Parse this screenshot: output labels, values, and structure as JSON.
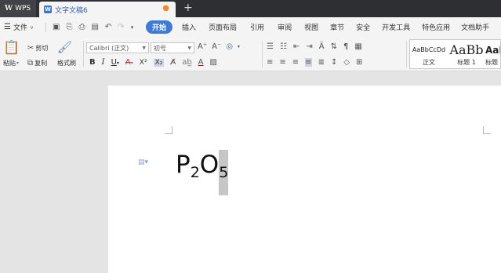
{
  "titlebar": {
    "app_name": "WPS",
    "doc_tab_title": "文字文稿6",
    "doc_icon_letter": "W",
    "close_glyph": "●",
    "new_tab_glyph": "+"
  },
  "menu": {
    "file_label": "文件",
    "tabs": [
      "开始",
      "插入",
      "页面布局",
      "引用",
      "审阅",
      "视图",
      "章节",
      "安全",
      "开发工具",
      "特色应用",
      "文档助手"
    ],
    "active_tab": "开始"
  },
  "ribbon": {
    "paste_label": "粘贴",
    "cut_label": "剪切",
    "copy_label": "复制",
    "format_painter_label": "格式刷",
    "font_name": "Calibri (正文)",
    "font_size": "初号",
    "bold": "B",
    "italic": "I",
    "underline": "U",
    "strike": "A",
    "superscript": "X²",
    "subscript": "X₂",
    "styles": [
      {
        "sample": "AaBbCcDd",
        "label": "正文"
      },
      {
        "sample": "AaBb",
        "label": "标题 1"
      },
      {
        "sample": "AaB",
        "label": "标题"
      }
    ]
  },
  "document": {
    "formula": {
      "p": "P",
      "sub1": "2",
      "o": "O",
      "sub2": "5"
    }
  },
  "colors": {
    "titlebar_bg": "#2d2f33",
    "accent": "#3e7bd6",
    "selection": "#c6c6c6"
  }
}
